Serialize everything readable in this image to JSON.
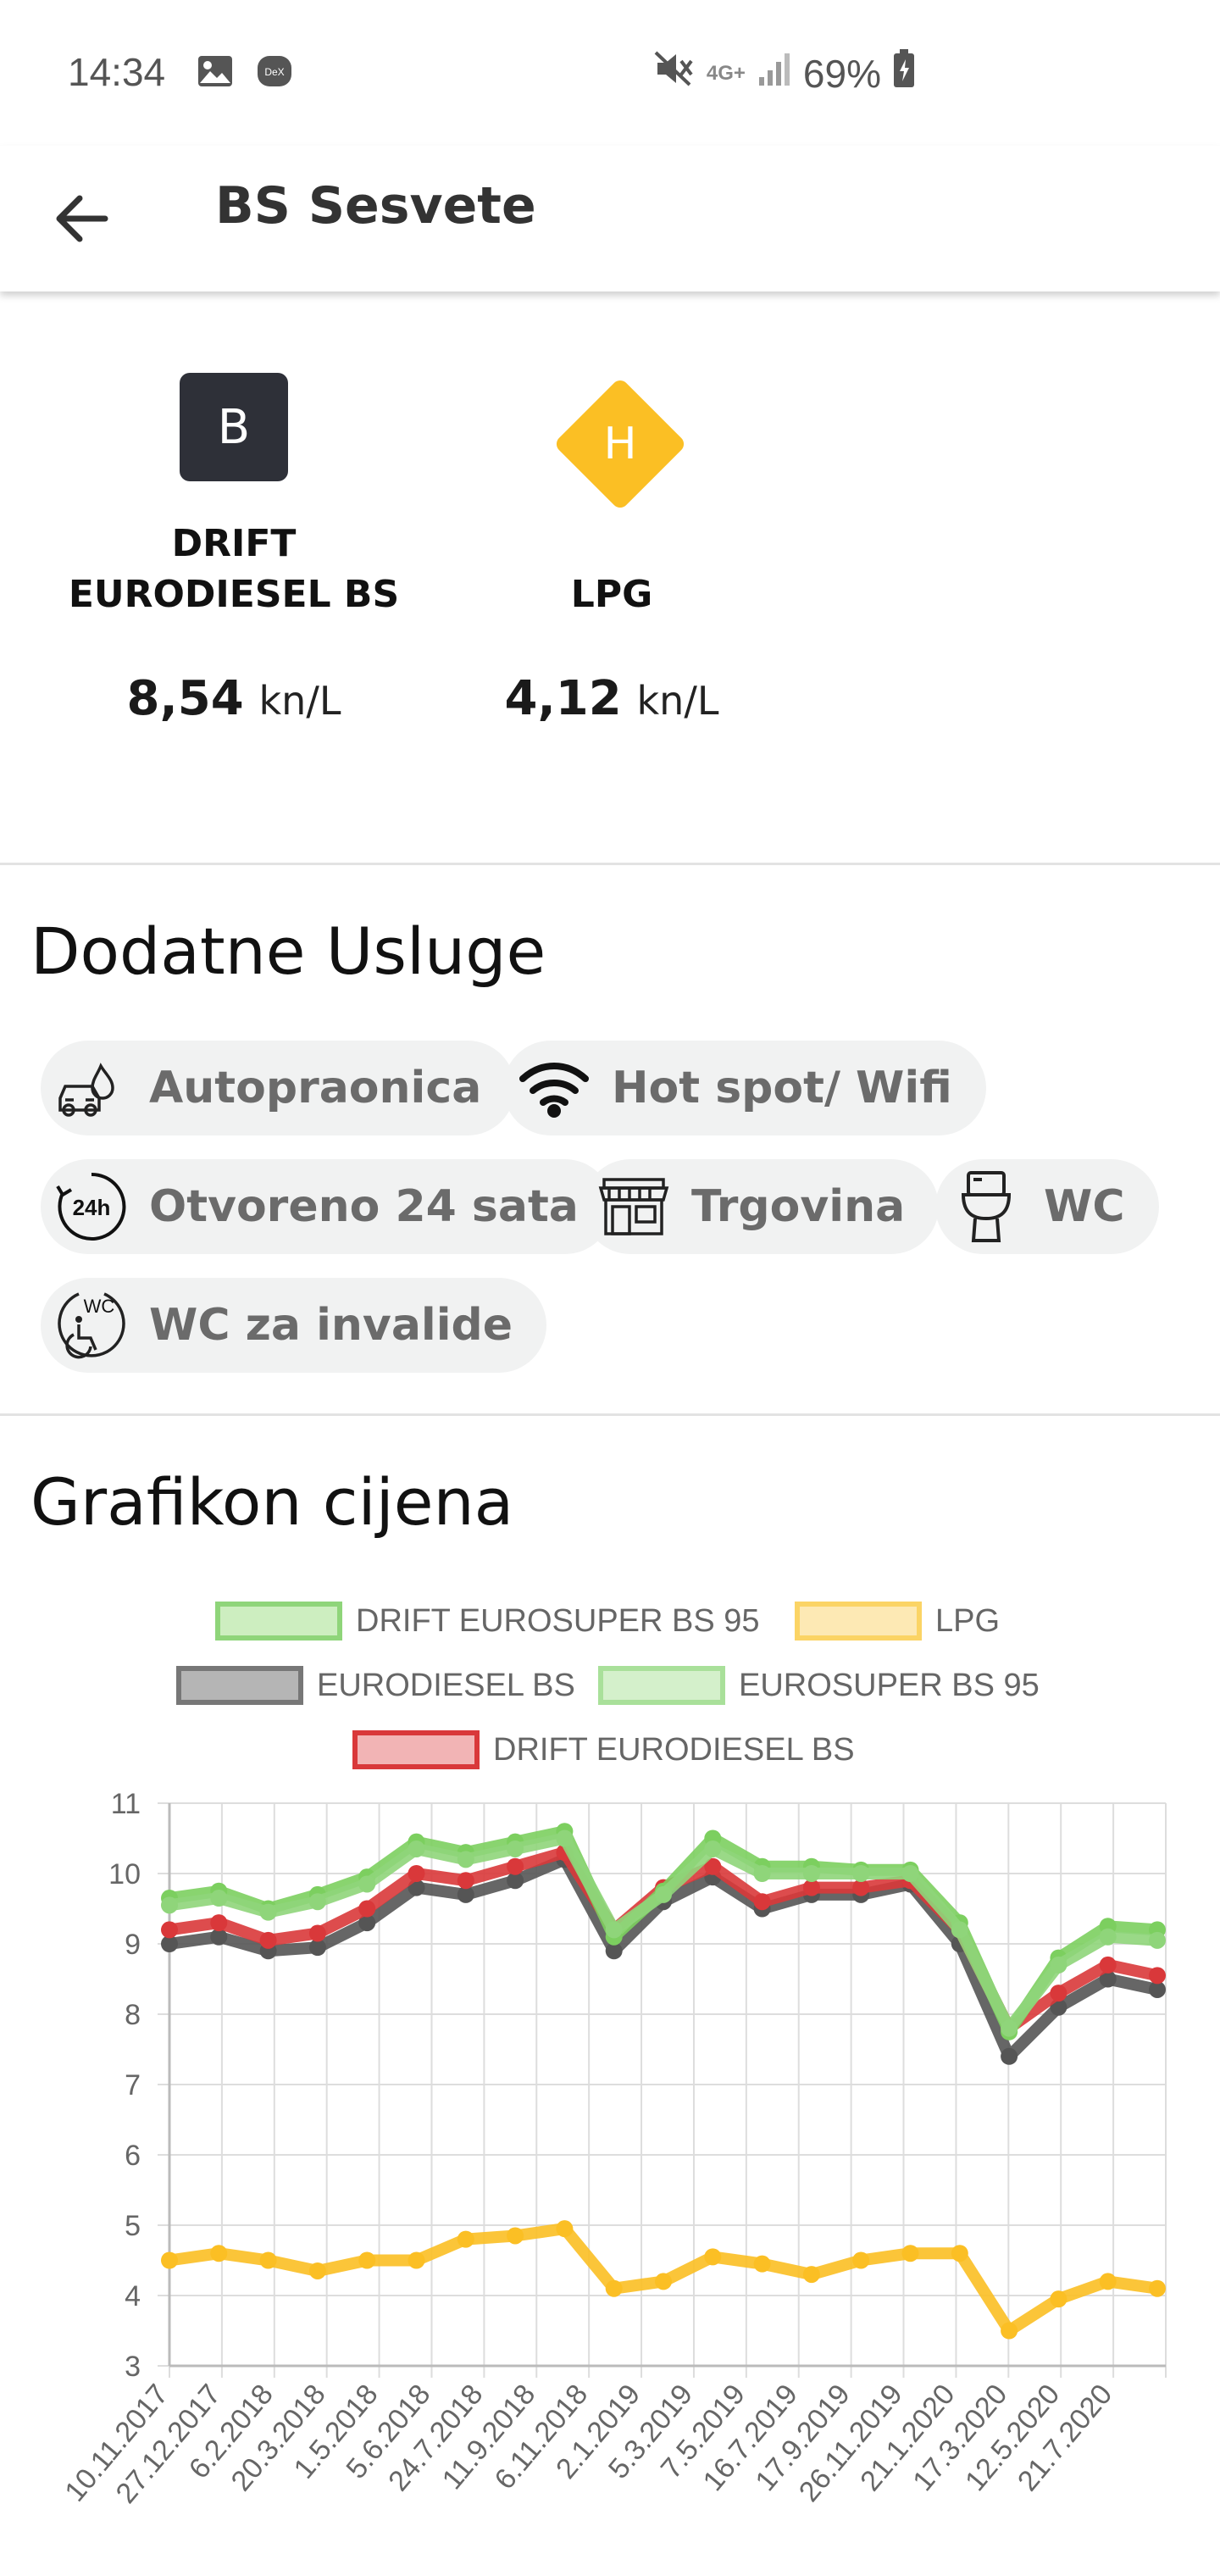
{
  "status_bar": {
    "time": "14:34",
    "network": "4G+",
    "battery": "69%",
    "icons": [
      "gallery-icon",
      "dex-icon",
      "mute-icon",
      "signal-icon",
      "battery-icon"
    ]
  },
  "app_bar": {
    "title": "BS Sesvete",
    "back_icon": "arrow-left-icon"
  },
  "fuels": [
    {
      "badge": "B",
      "badge_shape": "square",
      "badge_color": "#2e3038",
      "name_line1": "DRIFT",
      "name_line2": "EURODIESEL BS",
      "price": "8,54",
      "unit": "kn/L"
    },
    {
      "badge": "H",
      "badge_shape": "diamond",
      "badge_color": "#fbbf24",
      "name_line1": "",
      "name_line2": "LPG",
      "price": "4,12",
      "unit": "kn/L"
    }
  ],
  "services": {
    "title": "Dodatne Usluge",
    "items": [
      {
        "label": "Autopraonica",
        "icon": "car-wash-icon"
      },
      {
        "label": "Hot spot/ Wifi",
        "icon": "wifi-icon"
      },
      {
        "label": "Otvoreno 24 sata",
        "icon": "clock-24h-icon"
      },
      {
        "label": "Trgovina",
        "icon": "shop-icon"
      },
      {
        "label": "WC",
        "icon": "toilet-icon"
      },
      {
        "label": "WC za invalide",
        "icon": "accessible-wc-icon"
      }
    ]
  },
  "chart_section": {
    "title": "Grafikon cijena"
  },
  "chart_data": {
    "type": "line",
    "title": "",
    "xlabel": "",
    "ylabel": "",
    "ylim": [
      3,
      11
    ],
    "yticks": [
      3,
      4,
      5,
      6,
      7,
      8,
      9,
      10,
      11
    ],
    "grid": true,
    "legend_position": "top",
    "x": [
      "10.11.2017",
      "27.12.2017",
      "6.2.2018",
      "20.3.2018",
      "1.5.2018",
      "5.6.2018",
      "24.7.2018",
      "11.9.2018",
      "6.11.2018",
      "2.1.2019",
      "5.3.2019",
      "7.5.2019",
      "16.7.2019",
      "17.9.2019",
      "26.11.2019",
      "21.1.2020",
      "17.3.2020",
      "12.5.2020",
      "21.7.2020"
    ],
    "series": [
      {
        "name": "DRIFT EUROSUPER BS 95",
        "color": "#7ccf5f",
        "values": [
          9.65,
          9.75,
          9.5,
          9.7,
          9.95,
          10.45,
          10.3,
          10.45,
          10.6,
          9.1,
          9.75,
          10.5,
          10.1,
          10.1,
          10.05,
          10.05,
          9.3,
          7.75,
          8.8,
          9.25,
          9.2
        ]
      },
      {
        "name": "LPG",
        "color": "#fbbf24",
        "values": [
          4.5,
          4.6,
          4.5,
          4.35,
          4.5,
          4.5,
          4.8,
          4.85,
          4.95,
          4.1,
          4.2,
          4.55,
          4.45,
          4.3,
          4.5,
          4.6,
          4.6,
          3.5,
          3.95,
          4.2,
          4.1
        ]
      },
      {
        "name": "EURODIESEL BS",
        "color": "#555555",
        "values": [
          9.0,
          9.1,
          8.9,
          8.95,
          9.3,
          9.8,
          9.7,
          9.9,
          10.2,
          8.9,
          9.6,
          9.95,
          9.5,
          9.7,
          9.7,
          9.85,
          9.0,
          7.4,
          8.1,
          8.5,
          8.35
        ]
      },
      {
        "name": "EUROSUPER BS 95",
        "color": "#8fd57a",
        "values": [
          9.55,
          9.65,
          9.45,
          9.6,
          9.85,
          10.35,
          10.2,
          10.35,
          10.5,
          9.2,
          9.7,
          10.35,
          10.0,
          10.0,
          10.0,
          10.0,
          9.2,
          7.8,
          8.7,
          9.1,
          9.05
        ]
      },
      {
        "name": "DRIFT EURODIESEL BS",
        "color": "#d9383a",
        "values": [
          9.2,
          9.3,
          9.05,
          9.15,
          9.5,
          10.0,
          9.9,
          10.1,
          10.3,
          9.2,
          9.8,
          10.1,
          9.6,
          9.8,
          9.8,
          9.9,
          9.2,
          7.8,
          8.3,
          8.7,
          8.55
        ]
      }
    ],
    "legend_swatches": [
      {
        "label": "DRIFT EUROSUPER BS 95",
        "fill": "#cdeec0",
        "stroke": "#8fd57a"
      },
      {
        "label": "LPG",
        "fill": "#fde9b4",
        "stroke": "#fbd465"
      },
      {
        "label": "EURODIESEL BS",
        "fill": "#b5b5b5",
        "stroke": "#777777"
      },
      {
        "label": "EUROSUPER BS 95",
        "fill": "#d4f0cb",
        "stroke": "#a9e09a"
      },
      {
        "label": "DRIFT EURODIESEL BS",
        "fill": "#f2b4b5",
        "stroke": "#d9383a"
      }
    ]
  }
}
